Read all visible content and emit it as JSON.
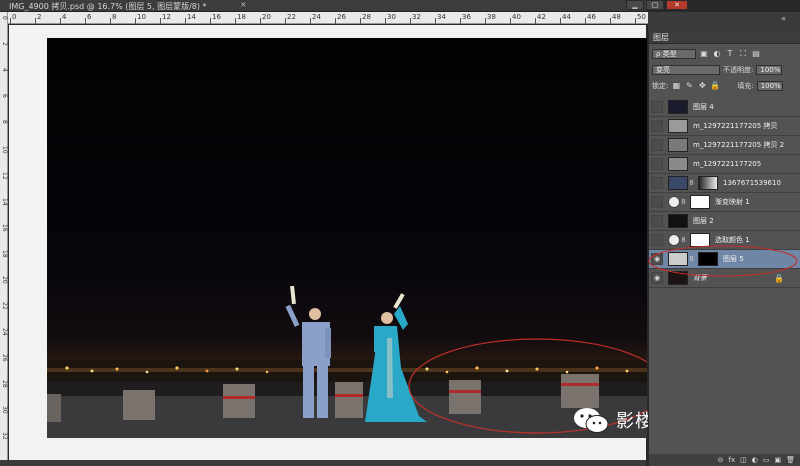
{
  "document": {
    "tab_title": "IMG_4900 拷贝.psd @ 16.7% (图层 5, 图层蒙版/8) *",
    "close_glyph": "×"
  },
  "window_controls": [
    "▁",
    "▢",
    "✕"
  ],
  "ruler": {
    "top_ticks": [
      "0",
      "2",
      "4",
      "6",
      "8",
      "10",
      "12",
      "14",
      "16",
      "18",
      "20",
      "22",
      "24",
      "26",
      "28",
      "30",
      "32",
      "34",
      "36",
      "38",
      "40",
      "42",
      "44",
      "46",
      "48",
      "50",
      "52"
    ],
    "left_ticks": [
      "0",
      "2",
      "4",
      "6",
      "8",
      "10",
      "12",
      "14",
      "16",
      "18",
      "20",
      "22",
      "24",
      "26",
      "28",
      "30",
      "32"
    ]
  },
  "panel": {
    "collapse_glyph": "«",
    "title": "图层",
    "filter_label": "ρ 类型",
    "filter_icons": [
      "▣",
      "◐",
      "T",
      "⛶",
      "▤"
    ],
    "blend_mode": "变亮",
    "opacity_label": "不透明度:",
    "opacity_value": "100%",
    "lock_label": "锁定:",
    "lock_icons": [
      "▦",
      "✎",
      "✥",
      "🔒"
    ],
    "fill_label": "填充:",
    "fill_value": "100%",
    "layers": [
      {
        "name": "图层 4",
        "visible": false,
        "thumb_color": "#1a1c2e"
      },
      {
        "name": "m_1297221177205 拷贝",
        "visible": false,
        "thumb_color": "#9a9a9a"
      },
      {
        "name": "m_1297221177205 拷贝 2",
        "visible": false,
        "thumb_color": "#7a7a7a"
      },
      {
        "name": "m_1297221177205",
        "visible": false,
        "thumb_color": "#8a8a8a"
      },
      {
        "name": "1367671539610",
        "visible": false,
        "thumb_color": "#3a4868"
      },
      {
        "name": "渐变映射 1",
        "visible": false,
        "thumb_color": "#ffffff"
      },
      {
        "name": "图层 2",
        "visible": false,
        "thumb_color": "#111111"
      },
      {
        "name": "选取颜色 1",
        "visible": false,
        "thumb_color": "#ffffff"
      },
      {
        "name": "图层 5",
        "visible": true,
        "thumb_color": "#cccccc"
      },
      {
        "name": "背景",
        "visible": true,
        "thumb_color": "#1a1412"
      }
    ],
    "footer_icons": [
      "⊝",
      "fx",
      "◫",
      "◐",
      "▭",
      "▣",
      "🗑"
    ]
  },
  "watermark": {
    "text": "影楼后期微刊"
  },
  "colors": {
    "selected_layer": "#6f86a6",
    "annotation_circle": "#c0302a"
  }
}
